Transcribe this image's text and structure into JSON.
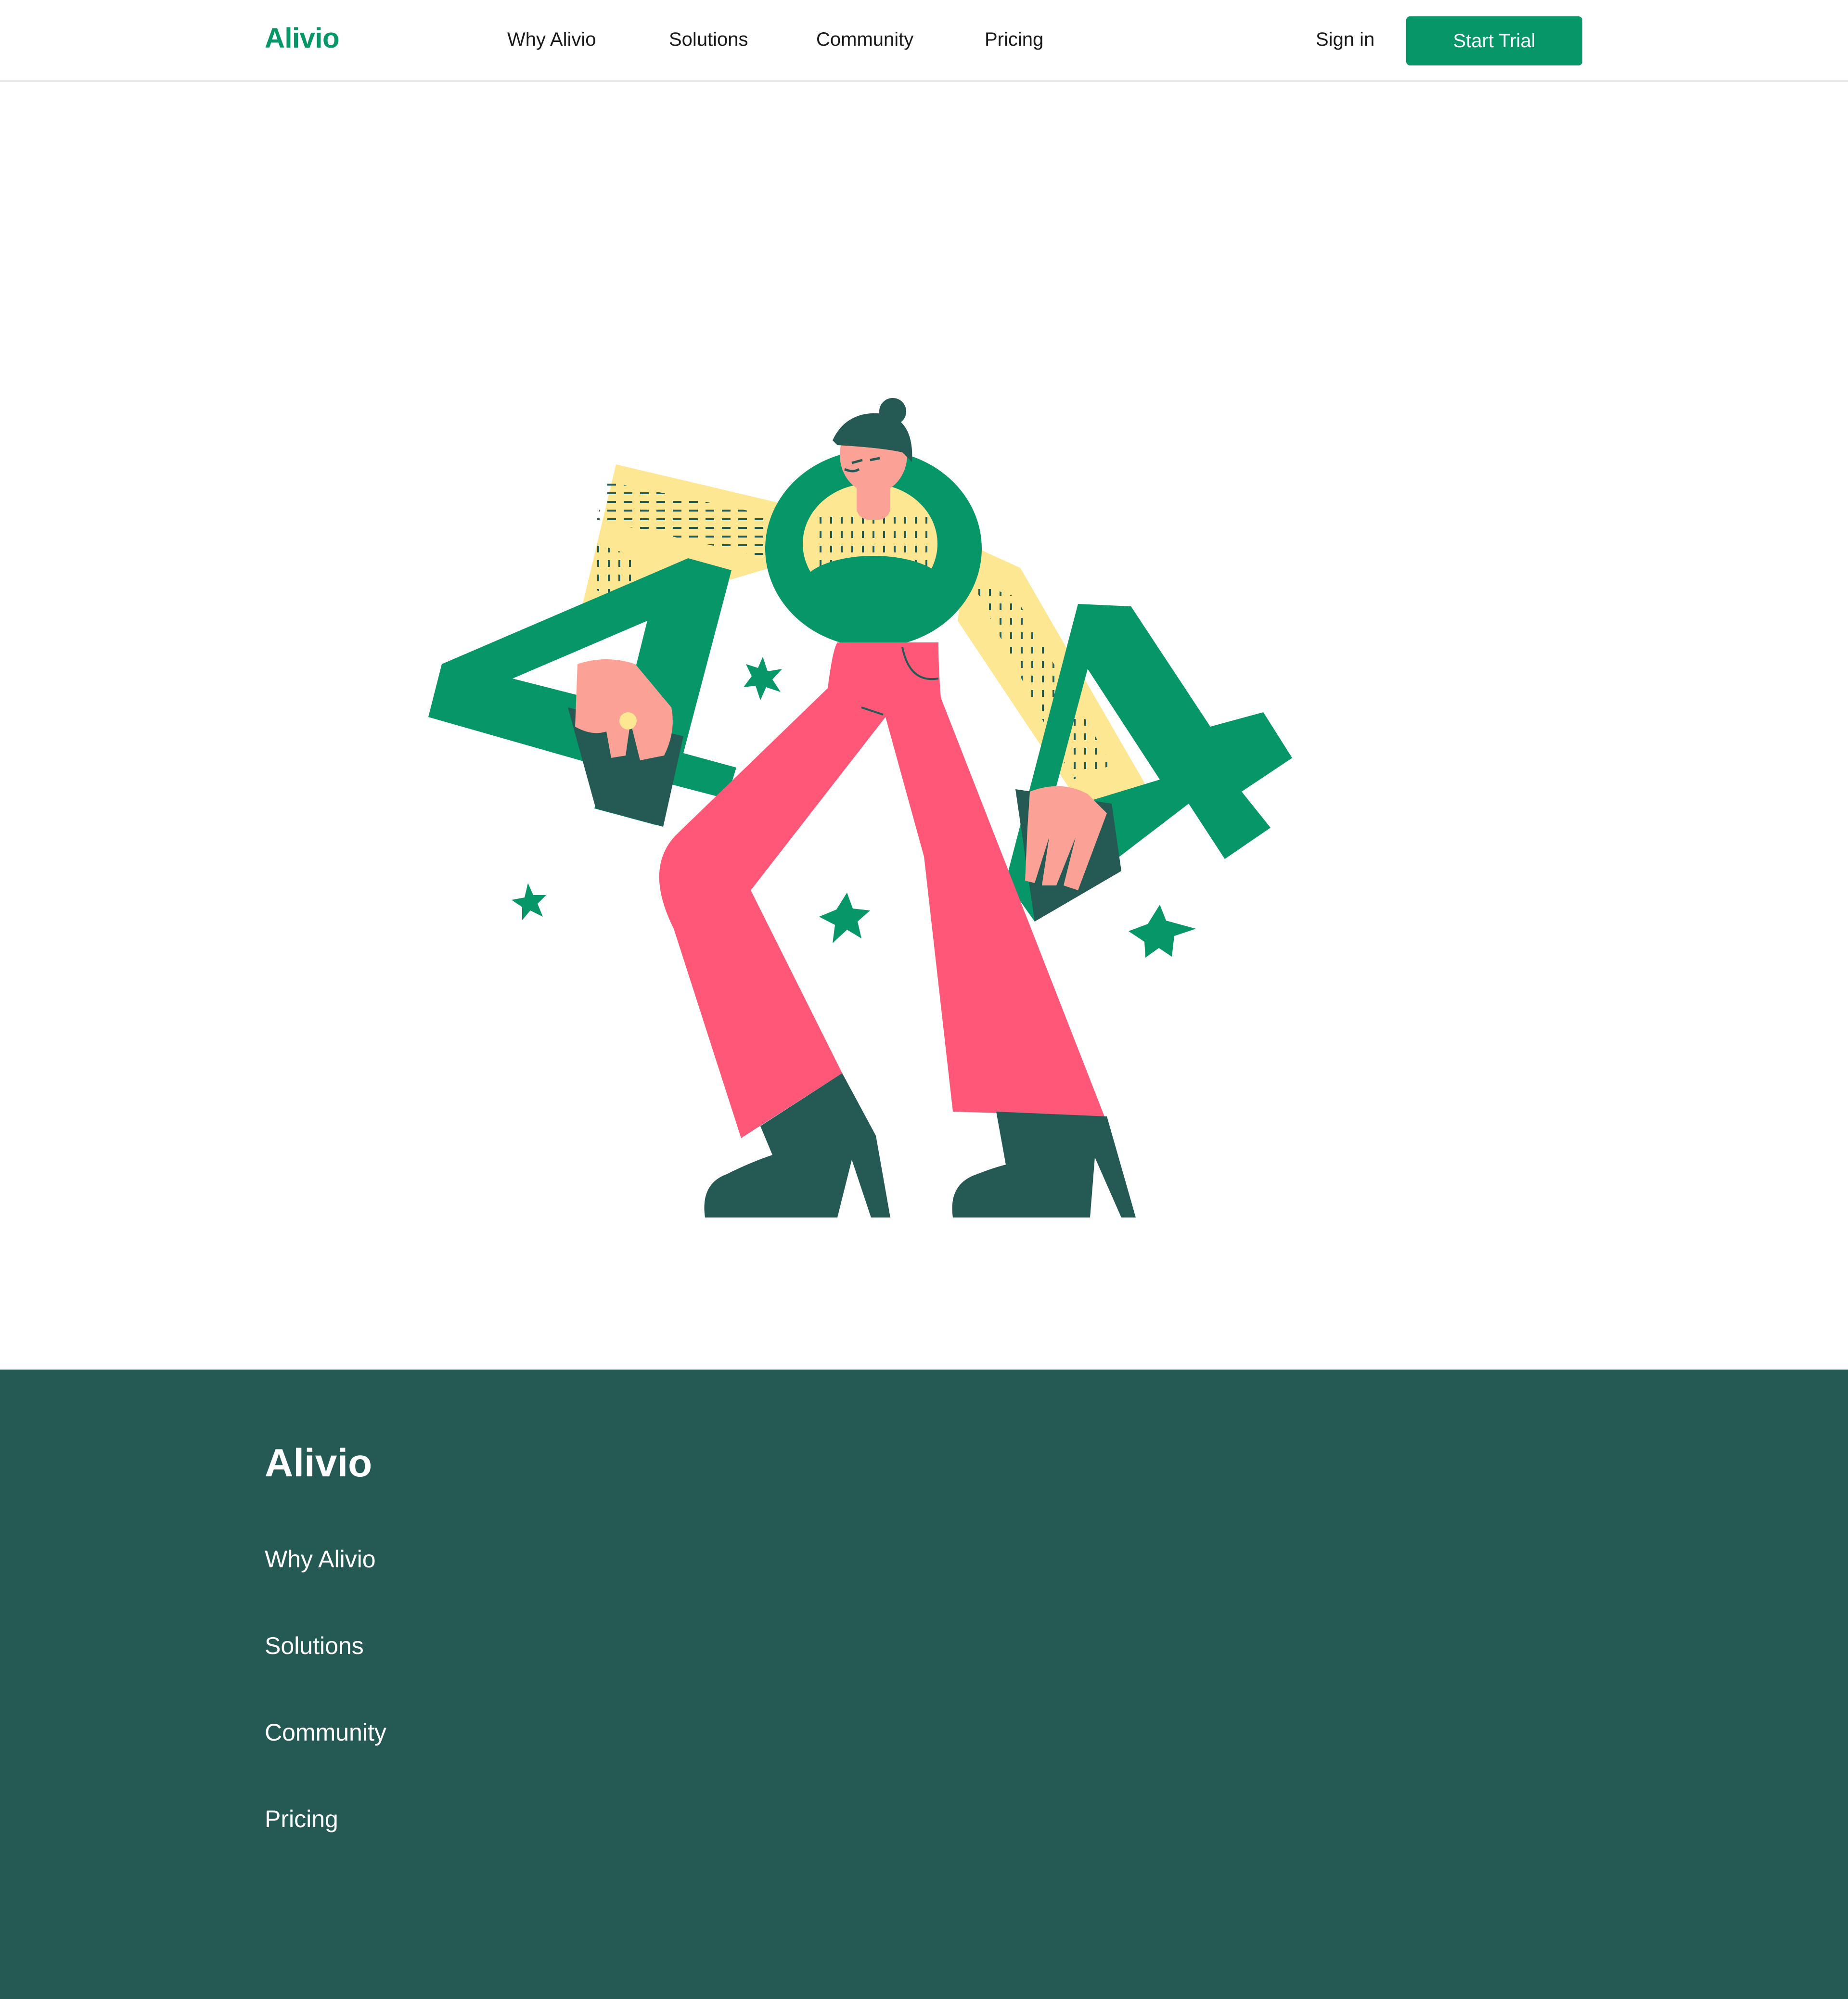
{
  "header": {
    "logo": "Alivio",
    "nav": [
      "Why Alivio",
      "Solutions",
      "Community",
      "Pricing"
    ],
    "signin": "Sign in",
    "cta": "Start Trial"
  },
  "hero": {
    "illustration": "404-woman-illustration"
  },
  "footer": {
    "logo": "Alivio",
    "links": [
      "Why Alivio",
      "Solutions",
      "Community",
      "Pricing"
    ]
  },
  "colors": {
    "brand_green": "#069668",
    "footer_bg": "#245a53",
    "pink": "#ff5777",
    "yellow": "#fde792",
    "skin": "#fca195",
    "dark_green": "#245a53"
  }
}
